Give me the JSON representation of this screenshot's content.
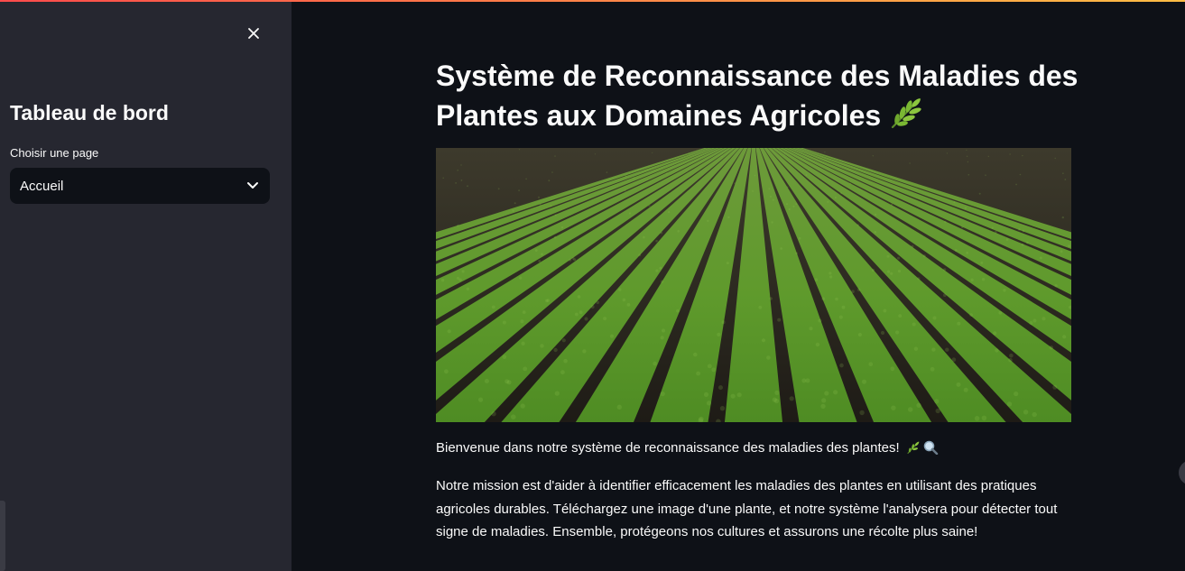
{
  "sidebar": {
    "title": "Tableau de bord",
    "select_label": "Choisir une page",
    "select_value": "Accueil"
  },
  "main": {
    "title": "Système de Reconnaissance des Maladies des Plantes aux Domaines Agricoles",
    "title_icon": "herb-icon",
    "hero_image": "crop-field-rows",
    "welcome_text": "Bienvenue dans notre système de reconnaissance des maladies des plantes!",
    "welcome_icons": [
      "herb-icon",
      "magnifier-icon"
    ],
    "mission_text": "Notre mission est d'aider à identifier efficacement les maladies des plantes en utilisant des pratiques agricoles durables. Téléchargez une image d'une plante, et notre système l'analysera pour détecter tout signe de maladies. Ensemble, protégeons nos cultures et assurons une récolte plus saine!"
  },
  "colors": {
    "background": "#0e1117",
    "sidebar": "#262730",
    "text": "#fafafa",
    "accent_start": "#ff4b4b",
    "accent_end": "#ffbd45"
  }
}
